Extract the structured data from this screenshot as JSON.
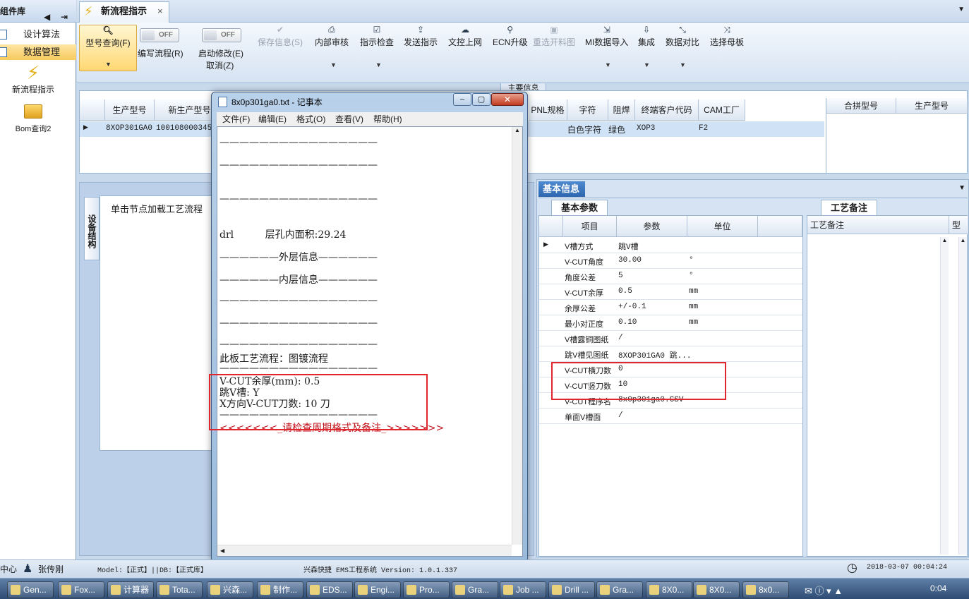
{
  "left_panel": {
    "header": "组件库",
    "items": [
      "设计算法",
      "数据管理"
    ],
    "shortcuts": [
      "新流程指示",
      "Bom查询2"
    ]
  },
  "tabs": [
    {
      "label": "新流程指示"
    }
  ],
  "toolbar": {
    "model_query": "型号查询(F)",
    "write_flow": "编写流程(R)",
    "start_modify": "启动修改(E)",
    "cancel": "取消(Z)",
    "off1": "OFF",
    "off2": "OFF",
    "buttons": [
      "保存信息(S)",
      "内部审核",
      "指示检查",
      "发送指示",
      "文控上网",
      "ECN升级",
      "重选开料图",
      "MI数据导入",
      "集成",
      "数据对比",
      "选择母板"
    ]
  },
  "main_info": {
    "section_title": "主要信息",
    "headers": [
      "生产型号",
      "新生产型号",
      "PNL规格",
      "字符",
      "阻焊",
      "终端客户代码",
      "CAM工厂"
    ],
    "row": [
      "8XOP301GA0",
      "1001080003451",
      "",
      "白色字符",
      "绿色",
      "XOP3",
      "F2"
    ],
    "merge_headers": [
      "合拼型号",
      "生产型号"
    ]
  },
  "left_pane": {
    "tab": "设备结构",
    "hint": "单击节点加载工艺流程"
  },
  "right_pane": {
    "title": "基本信息",
    "subtab": "基本参数",
    "remark_tab": "工艺备注",
    "remark_header": "工艺备注",
    "remark_col2": "型",
    "headers": [
      "项目",
      "参数",
      "单位"
    ],
    "rows": [
      [
        "V槽方式",
        "跳V槽",
        ""
      ],
      [
        "V-CUT角度",
        "30.00",
        "°"
      ],
      [
        "角度公差",
        "5",
        "°"
      ],
      [
        "V-CUT余厚",
        "0.5",
        "mm"
      ],
      [
        "余厚公差",
        "+/-0.1",
        "mm"
      ],
      [
        "最小对正度",
        "0.10",
        "mm"
      ],
      [
        "V槽露铜图纸",
        "/",
        ""
      ],
      [
        "跳V槽见图纸",
        "8XOP301GA0 跳...",
        ""
      ],
      [
        "V-CUT横刀数",
        "0",
        ""
      ],
      [
        "V-CUT竖刀数",
        "10",
        ""
      ],
      [
        "V-CUT程序名",
        "8x0p301ga0.CSV",
        ""
      ],
      [
        "单面V槽面",
        "/",
        ""
      ]
    ]
  },
  "notepad": {
    "title": "8x0p301ga0.txt - 记事本",
    "menu": [
      "文件(F)",
      "编辑(E)",
      "格式(O)",
      "查看(V)",
      "帮助(H)"
    ],
    "lines": [
      {
        "t": "————————————————"
      },
      {
        "t": "————————————————"
      },
      {
        "t": "————————————————"
      },
      {
        "t": "drl          层孔内面积:29.24"
      },
      {
        "t": "——————外层信息——————"
      },
      {
        "t": "——————内层信息——————"
      },
      {
        "t": "————————————————"
      },
      {
        "t": "————————————————"
      },
      {
        "t": "————————————————"
      },
      {
        "t": "此板工艺流程：图镀流程"
      },
      {
        "t": "————————————————"
      },
      {
        "t": "V-CUT余厚(mm): 0.5"
      },
      {
        "t": "跳V槽: Y"
      },
      {
        "t": "X方向V-CUT刀数: 10 刀"
      },
      {
        "t": "————————————————"
      },
      {
        "t": "<<<<<<<_请检查周期格式及备注_>>>>>>>"
      }
    ]
  },
  "status": {
    "center": "中心",
    "user": "张传刚",
    "model": "Model:【正式】||DB:【正式库】",
    "system": "兴森快捷 EMS工程系统 Version: 1.0.1.337",
    "datetime": "2018-03-07 00:04:24"
  },
  "taskbar": {
    "items": [
      "Gen...",
      "Fox...",
      "计算器",
      "Tota...",
      "兴森...",
      "制作...",
      "EDS...",
      "Engi...",
      "Pro...",
      "Gra...",
      "Job ...",
      "Drill ...",
      "Gra...",
      "8X0...",
      "8X0...",
      "8x0..."
    ],
    "clock": "0:04"
  }
}
